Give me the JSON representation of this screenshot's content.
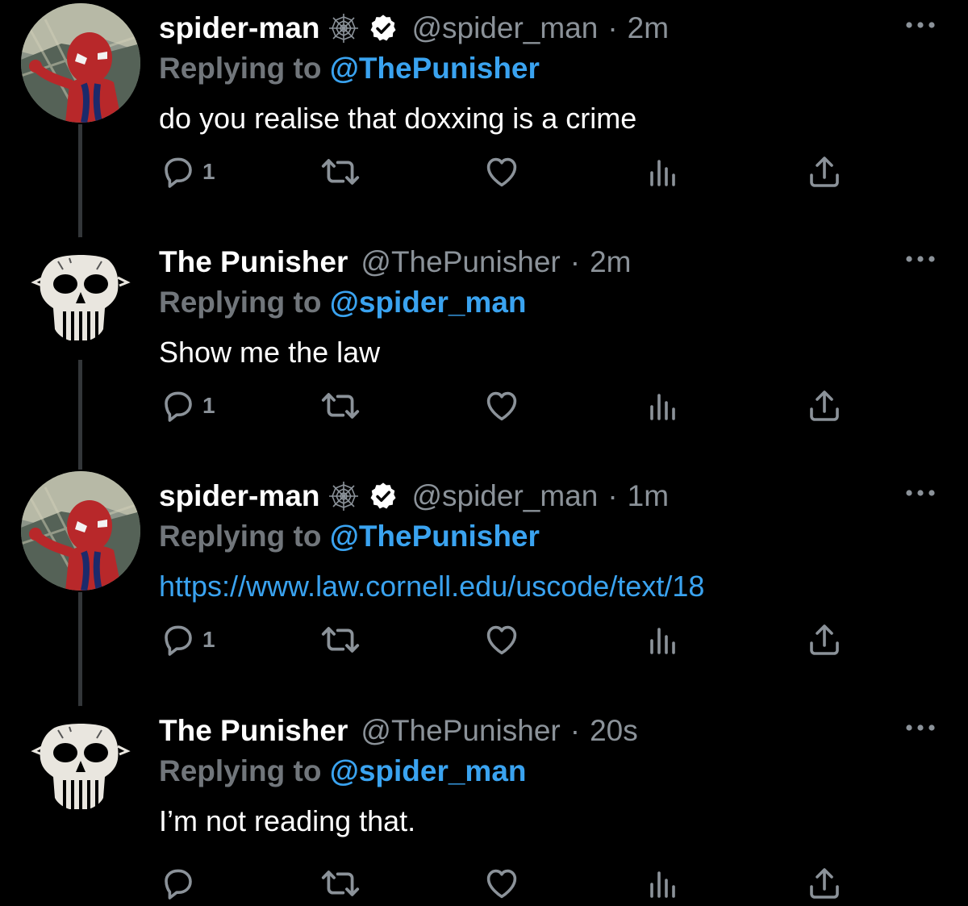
{
  "colors": {
    "background": "#000000",
    "text": "#ffffff",
    "secondary": "#8b9299",
    "link": "#3aa3f0",
    "thread_line": "#333639"
  },
  "tweets": [
    {
      "display_name": "spider-man",
      "handle": "@spider_man",
      "separator": "·",
      "time": "2m",
      "badges": [
        "spider-web-icon",
        "verified-badge-icon"
      ],
      "avatar": "spider-man-avatar",
      "reply_prefix": "Replying to",
      "reply_mention": "@ThePunisher",
      "text": "do you realise that doxxing is a crime",
      "reply_count": "1"
    },
    {
      "display_name": "The Punisher",
      "handle": "@ThePunisher",
      "separator": "·",
      "time": "2m",
      "avatar": "punisher-skull-avatar",
      "reply_prefix": "Replying to",
      "reply_mention": "@spider_man",
      "text": "Show me the law",
      "reply_count": "1"
    },
    {
      "display_name": "spider-man",
      "handle": "@spider_man",
      "separator": "·",
      "time": "1m",
      "badges": [
        "spider-web-icon",
        "verified-badge-icon"
      ],
      "avatar": "spider-man-avatar",
      "reply_prefix": "Replying to",
      "reply_mention": "@ThePunisher",
      "text": "https://www.law.cornell.edu/uscode/text/18",
      "reply_count": "1"
    },
    {
      "display_name": "The Punisher",
      "handle": "@ThePunisher",
      "separator": "·",
      "time": "20s",
      "avatar": "punisher-skull-avatar",
      "reply_prefix": "Replying to",
      "reply_mention": "@spider_man",
      "text": "I’m not reading that.",
      "reply_count": ""
    }
  ],
  "action_icons": [
    "reply-icon",
    "retweet-icon",
    "like-icon",
    "views-icon",
    "share-icon"
  ]
}
